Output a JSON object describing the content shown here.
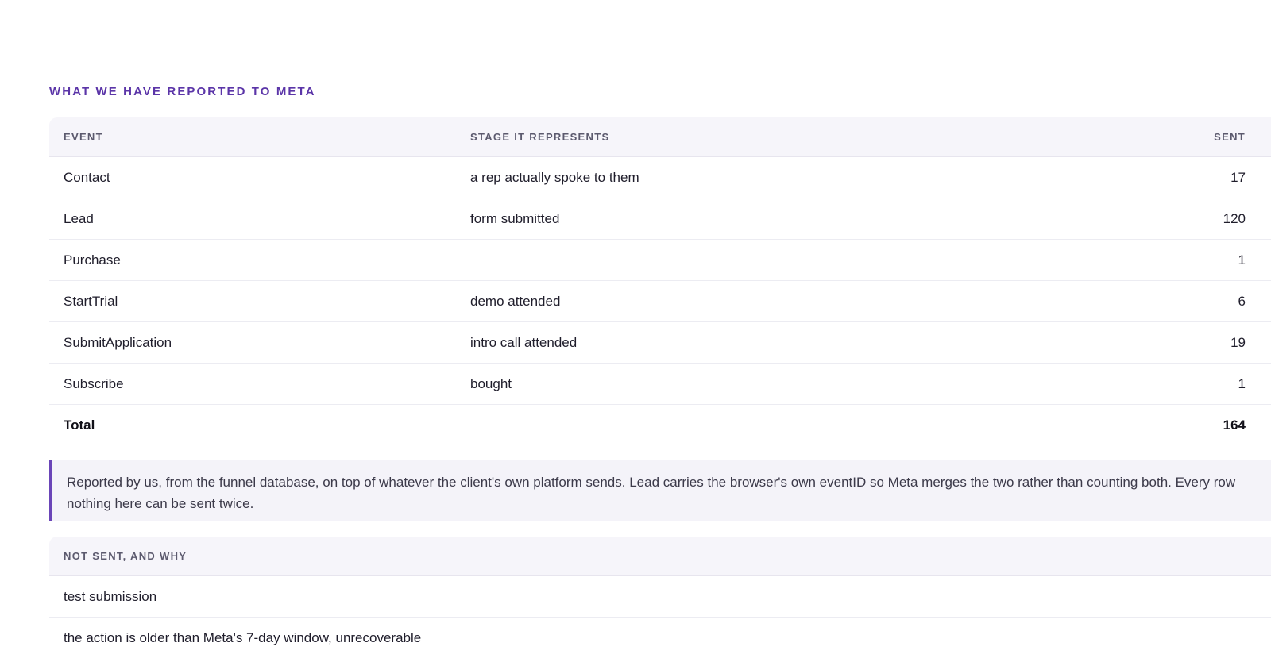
{
  "section": {
    "title": "WHAT WE HAVE REPORTED TO META"
  },
  "events_table": {
    "headers": {
      "event": "EVENT",
      "stage": "STAGE IT REPRESENTS",
      "sent": "SENT"
    },
    "rows": [
      {
        "event": "Contact",
        "stage": "a rep actually spoke to them",
        "sent": "17"
      },
      {
        "event": "Lead",
        "stage": "form submitted",
        "sent": "120"
      },
      {
        "event": "Purchase",
        "stage": "",
        "sent": "1"
      },
      {
        "event": "StartTrial",
        "stage": "demo attended",
        "sent": "6"
      },
      {
        "event": "SubmitApplication",
        "stage": "intro call attended",
        "sent": "19"
      },
      {
        "event": "Subscribe",
        "stage": "bought",
        "sent": "1"
      }
    ],
    "total": {
      "label": "Total",
      "sent": "164"
    }
  },
  "note": {
    "line1": "Reported by us, from the funnel database, on top of whatever the client's own platform sends. Lead carries the browser's own eventID so Meta merges the two rather than counting both. Every row",
    "line2": "nothing here can be sent twice."
  },
  "not_sent_table": {
    "header": "NOT SENT, AND WHY",
    "rows": [
      {
        "reason": "test submission"
      },
      {
        "reason": "the action is older than Meta's 7-day window, unrecoverable"
      }
    ]
  }
}
